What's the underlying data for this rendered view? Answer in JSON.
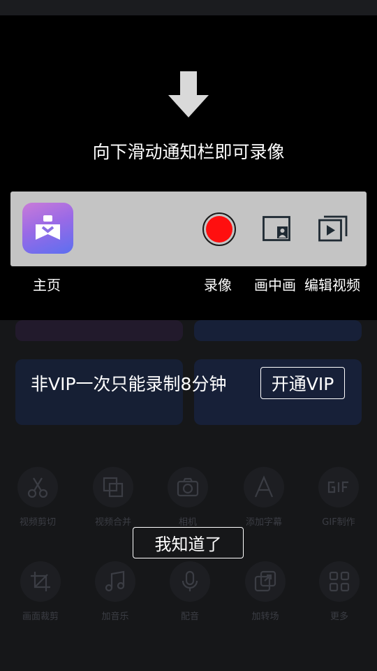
{
  "overlay": {
    "hint": "向下滑动通知栏即可录像",
    "labels": {
      "home": "主页",
      "record": "录像",
      "pip": "画中画",
      "edit": "编辑视频"
    }
  },
  "vip": {
    "message": "非VIP一次只能录制8分钟",
    "button": "开通VIP"
  },
  "dismiss_button": "我知道了",
  "tools": [
    {
      "label": "视频剪切",
      "icon": "scissors-icon"
    },
    {
      "label": "视频合并",
      "icon": "merge-icon"
    },
    {
      "label": "相机",
      "icon": "camera-icon"
    },
    {
      "label": "添加字幕",
      "icon": "text-icon"
    },
    {
      "label": "GIF制作",
      "icon": "gif-icon"
    },
    {
      "label": "画面裁剪",
      "icon": "crop-icon"
    },
    {
      "label": "加音乐",
      "icon": "music-icon"
    },
    {
      "label": "配音",
      "icon": "microphone-icon"
    },
    {
      "label": "加转场",
      "icon": "transition-icon"
    },
    {
      "label": "更多",
      "icon": "grid-icon"
    }
  ],
  "colors": {
    "record": "#ff0f0f",
    "overlay": "#000000",
    "notification_bg": "#c4c4c4"
  }
}
